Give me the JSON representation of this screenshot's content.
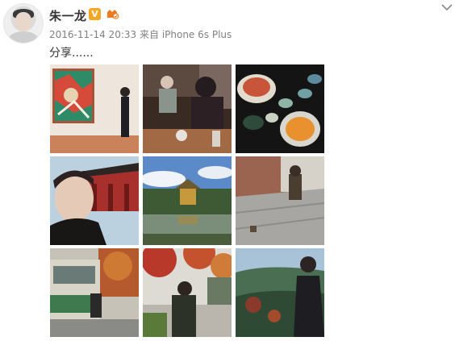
{
  "post": {
    "user_name": "朱一龙",
    "verified_badge": "V",
    "timestamp": "2016-11-14 20:33",
    "source_prefix": "来自",
    "source_device": "iPhone 6s Plus",
    "text": "分享......"
  },
  "icons": {
    "verified": "verified-v-icon",
    "member": "weibo-member-icon",
    "menu": "chevron-down-icon"
  },
  "colors": {
    "name": "#333333",
    "meta": "#808080",
    "verified": "#f5a623",
    "member": "#f0781e"
  },
  "photos": [
    {
      "description_key": "museum-painting"
    },
    {
      "description_key": "cafe-table"
    },
    {
      "description_key": "dinner-dishes"
    },
    {
      "description_key": "selfie-temple"
    },
    {
      "description_key": "golden-pavilion"
    },
    {
      "description_key": "street-crouch"
    },
    {
      "description_key": "tram-street"
    },
    {
      "description_key": "autumn-maple"
    },
    {
      "description_key": "hill-view"
    }
  ]
}
